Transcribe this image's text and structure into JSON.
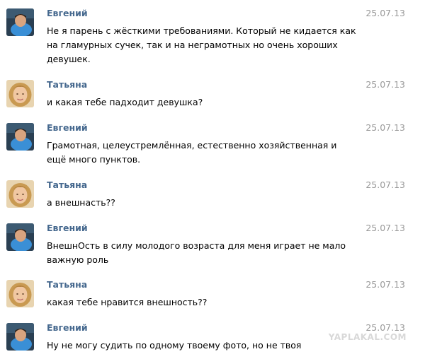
{
  "messages": [
    {
      "author": "Евгений",
      "avatar": "male-avatar",
      "date": "25.07.13",
      "text": "Не я парень с жёсткими требованиями. Который не кидается как на гламурных сучек, так и на неграмотных но очень хороших девушек."
    },
    {
      "author": "Татьяна",
      "avatar": "female-avatar",
      "date": "25.07.13",
      "text": "и какая тебе падходит девушка?"
    },
    {
      "author": "Евгений",
      "avatar": "male-avatar",
      "date": "25.07.13",
      "text": "Грамотная, целеустремлённая, естественно хозяйственная и ещё много пунктов."
    },
    {
      "author": "Татьяна",
      "avatar": "female-avatar",
      "date": "25.07.13",
      "text": "а внешнасть??"
    },
    {
      "author": "Евгений",
      "avatar": "male-avatar",
      "date": "25.07.13",
      "text": "ВнешнОсть в силу молодого возраста для меня играет не мало важную роль"
    },
    {
      "author": "Татьяна",
      "avatar": "female-avatar",
      "date": "25.07.13",
      "text": "какая тебе нравится внешность??"
    },
    {
      "author": "Евгений",
      "avatar": "male-avatar",
      "date": "25.07.13",
      "text": "Ну не могу судить по одному твоему фото, но не твоя"
    }
  ],
  "watermark": "YAPLAKAL.COM",
  "colors": {
    "author": "#45688e",
    "date": "#999999",
    "text": "#000000",
    "background": "#ffffff"
  }
}
